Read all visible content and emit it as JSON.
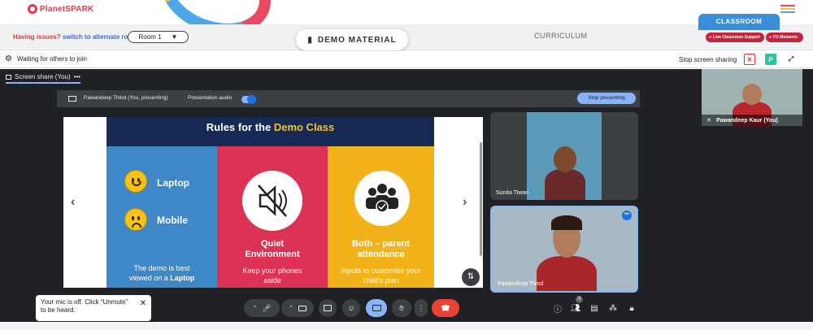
{
  "header": {
    "logo_text": "PlanetSPARK",
    "issues_text": "Having issues?",
    "alternate_link": "switch to alternate room",
    "room_select": "Room 1",
    "demo_material": "DEMO MATERIAL",
    "curriculum": "CURRICULUM",
    "classroom_tab": "CLASSROOM",
    "live_support": "Live Classroom Support",
    "ps_moments": "PS Moments",
    "hamburger_colors": [
      "#e84a64",
      "#f6c12b",
      "#4da6e8"
    ]
  },
  "status": {
    "waiting": "Waiting for others to join",
    "stop_sharing": "Stop screen sharing",
    "p_badge": "P"
  },
  "meeting": {
    "screen_share_label": "Screen share (You)",
    "presenter": "Pawandeep Thind (You, presenting)",
    "presentation_audio": "Presentation audio",
    "stop_presenting": "Stop presenting"
  },
  "slide": {
    "title_prefix": "Rules for the ",
    "title_highlight": "Demo Class",
    "col1": {
      "word1": "Laptop",
      "word2": "Mobile",
      "body1": "The demo is best",
      "body2": "viewed on a ",
      "body3": "Laptop"
    },
    "col2": {
      "title1": "Quiet",
      "title2": "Environment",
      "body1": "Keep your phones",
      "body2": "aside"
    },
    "col3": {
      "title1": "Both – parent",
      "title2": "attendance",
      "body1": "Inputs to customise your",
      "body2": "child's plan"
    }
  },
  "participants": {
    "self_top": "Pawandeep Kaur (You)",
    "tile1": "Sunita Tiwari",
    "tile2": "Pawandeep Thind"
  },
  "controls": {
    "people_count": "3"
  },
  "toast": {
    "line1": "Your mic is off. Click “Unmute”",
    "line2": "to be heard."
  }
}
